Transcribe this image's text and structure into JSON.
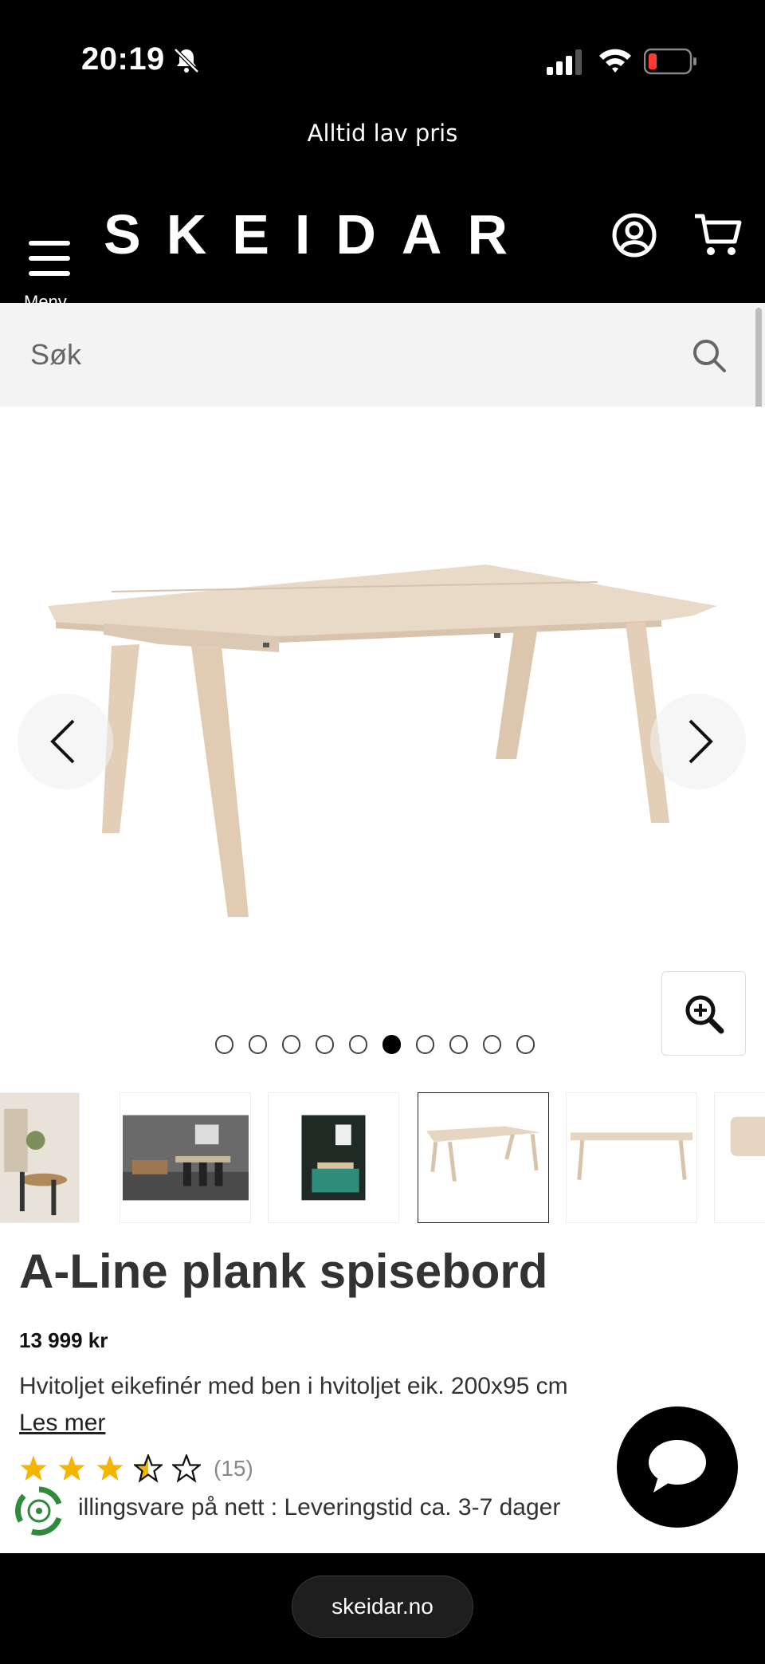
{
  "status_bar": {
    "time": "20:19"
  },
  "promo": {
    "text": "Alltid lav pris"
  },
  "header": {
    "menu_label": "Meny",
    "logo": "SKEIDAR"
  },
  "search": {
    "placeholder": "Søk"
  },
  "gallery": {
    "dot_count": 10,
    "active_dot": 6
  },
  "product": {
    "title": "A-Line plank spisebord",
    "price": "13 999 kr",
    "description": "Hvitoljet eikefinér med ben i hvitoljet eik. 200x95 cm",
    "read_more": "Les mer",
    "rating": 3.5,
    "review_count": "(15)",
    "delivery": "illingsvare på nett : Leveringstid ca. 3-7 dager"
  },
  "browser": {
    "url": "skeidar.no"
  },
  "colors": {
    "header_bg": "#000000",
    "star": "#f5b400",
    "search_bg": "#f3f3f3"
  },
  "icons": [
    "menu-icon",
    "account-icon",
    "cart-icon",
    "search-icon",
    "chevron-left-icon",
    "chevron-right-icon",
    "zoom-in-icon",
    "chat-icon",
    "eco-badge-icon"
  ]
}
